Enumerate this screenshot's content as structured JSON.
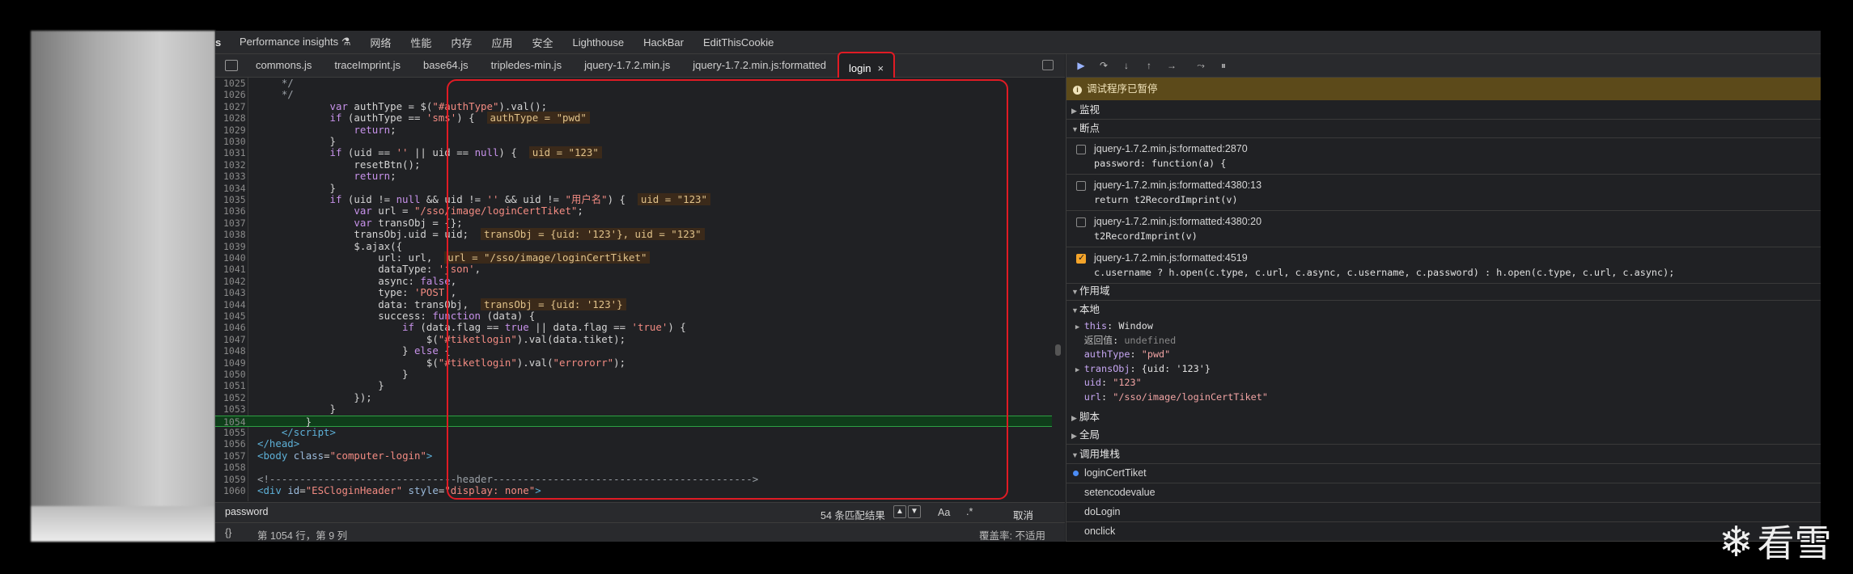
{
  "top_tabs": [
    "Performance insights ⚗",
    "网络",
    "性能",
    "内存",
    "应用",
    "安全",
    "Lighthouse",
    "HackBar",
    "EditThisCookie"
  ],
  "file_tabs": [
    "commons.js",
    "traceImprint.js",
    "base64.js",
    "tripledes-min.js",
    "jquery-1.7.2.min.js",
    "jquery-1.7.2.min.js:formatted"
  ],
  "active_tab": {
    "label": "login",
    "close": "×"
  },
  "editor_lines": [
    {
      "n": "1025",
      "html": "    <span class='cm'>*/</span>"
    },
    {
      "n": "1026",
      "html": "    <span class='cm'>*/</span>"
    },
    {
      "n": "1027",
      "html": "            <span class='kw'>var</span> authType = $(<span class='str'>\"#authType\"</span>).val();"
    },
    {
      "n": "1028",
      "html": "            <span class='kw'>if</span> (authType == <span class='str'>'sms'</span>) {  <span class='inl'>authType = \"pwd\"</span>"
    },
    {
      "n": "1029",
      "html": "                <span class='kw'>return</span>;"
    },
    {
      "n": "1030",
      "html": "            }"
    },
    {
      "n": "1031",
      "html": "            <span class='kw'>if</span> (uid == <span class='str'>''</span> || uid == <span class='kw'>null</span>) {  <span class='inl'>uid = \"123\"</span>"
    },
    {
      "n": "1032",
      "html": "                resetBtn();"
    },
    {
      "n": "1033",
      "html": "                <span class='kw'>return</span>;"
    },
    {
      "n": "1034",
      "html": "            }"
    },
    {
      "n": "1035",
      "html": "            <span class='kw'>if</span> (uid != <span class='kw'>null</span> &amp;&amp; uid != <span class='str'>''</span> &amp;&amp; uid != <span class='str'>\"用户名\"</span>) {  <span class='inl'>uid = \"123\"</span>"
    },
    {
      "n": "1036",
      "html": "                <span class='kw'>var</span> url = <span class='str'>\"/sso/image/loginCertTiket\"</span>;"
    },
    {
      "n": "1037",
      "html": "                <span class='kw'>var</span> transObj = {};"
    },
    {
      "n": "1038",
      "html": "                transObj.uid = uid;  <span class='inl'>transObj = {uid: '123'}, uid = \"123\"</span>"
    },
    {
      "n": "1039",
      "html": "                $.ajax({"
    },
    {
      "n": "1040",
      "html": "                    url: url,  <span class='inl'>url = \"/sso/image/loginCertTiket\"</span>"
    },
    {
      "n": "1041",
      "html": "                    dataType: <span class='str'>'json'</span>,"
    },
    {
      "n": "1042",
      "html": "                    async: <span class='kw'>false</span>,"
    },
    {
      "n": "1043",
      "html": "                    type: <span class='str'>'POST'</span>,"
    },
    {
      "n": "1044",
      "html": "                    data: transObj,  <span class='inl'>transObj = {uid: '123'}</span>"
    },
    {
      "n": "1045",
      "html": "                    success: <span class='kw'>function</span> (data) {"
    },
    {
      "n": "1046",
      "html": "                        <span class='kw'>if</span> (data.flag == <span class='kw'>true</span> || data.flag == <span class='str'>'true'</span>) {"
    },
    {
      "n": "1047",
      "html": "                            $(<span class='str'>\"#tiketlogin\"</span>).val(data.tiket);"
    },
    {
      "n": "1048",
      "html": "                        } <span class='kw'>else</span> {"
    },
    {
      "n": "1049",
      "html": "                            $(<span class='str'>\"#tiketlogin\"</span>).val(<span class='str'>\"errororr\"</span>);"
    },
    {
      "n": "1050",
      "html": "                        }"
    },
    {
      "n": "1051",
      "html": "                    }"
    },
    {
      "n": "1052",
      "html": "                });"
    },
    {
      "n": "1053",
      "html": "            }"
    },
    {
      "n": "1054",
      "html": "        }",
      "current": true
    },
    {
      "n": "1055",
      "html": "    <span class='tag'>&lt;/script&gt;</span>"
    },
    {
      "n": "1056",
      "html": "<span class='tag'>&lt;/head&gt;</span>"
    },
    {
      "n": "1057",
      "html": "<span class='tag'>&lt;body</span> <span class='attr'>class</span>=<span class='val'>\"computer-login\"</span><span class='tag'>&gt;</span>"
    },
    {
      "n": "1058",
      "html": ""
    },
    {
      "n": "1059",
      "html": "<span class='cm'>&lt;!-------------------------------header-------------------------------------------&gt;</span>"
    },
    {
      "n": "1060",
      "html": "<span class='tag'>&lt;div</span> <span class='attr'>id</span>=<span class='val'>\"ESCloginHeader\"</span> <span class='attr'>style</span>=<span class='val'>\"display: none\"</span><span class='tag'>&gt;</span>"
    }
  ],
  "search": {
    "query": "password",
    "count": "54 条匹配结果",
    "match_case": "Aa",
    "regex": ".*",
    "cancel": "取消"
  },
  "status": {
    "braces": "{}",
    "position": "第 1054 行，第 9 列",
    "coverage": "覆盖率: 不适用"
  },
  "paused_msg": "调试程序已暂停",
  "sections": {
    "watch": "监视",
    "breakpoints": "断点",
    "scope": "作用域",
    "local": "本地",
    "script": "脚本",
    "global": "全局",
    "callstack": "调用堆栈"
  },
  "breakpoints": [
    {
      "loc": "jquery-1.7.2.min.js:formatted:2870",
      "src": "password: function(a) {",
      "checked": false
    },
    {
      "loc": "jquery-1.7.2.min.js:formatted:4380:13",
      "src": "return t2RecordImprint(v)",
      "checked": false
    },
    {
      "loc": "jquery-1.7.2.min.js:formatted:4380:20",
      "src": "t2RecordImprint(v)",
      "checked": false
    },
    {
      "loc": "jquery-1.7.2.min.js:formatted:4519",
      "src": "c.username ? h.open(c.type, c.url, c.async, c.username, c.password) : h.open(c.type, c.url, c.async);",
      "checked": true
    }
  ],
  "scope_local": [
    {
      "k": "this",
      "sep": ": ",
      "v": "Window",
      "expand": true,
      "kind": "obj"
    },
    {
      "k": "返回值",
      "sep": ": ",
      "v": "undefined",
      "expand": false,
      "kind": "undef"
    },
    {
      "k": "authType",
      "sep": ": ",
      "v": "\"pwd\"",
      "expand": false,
      "kind": "str"
    },
    {
      "k": "transObj",
      "sep": ": ",
      "v": "{uid: '123'}",
      "expand": true,
      "kind": "obj"
    },
    {
      "k": "uid",
      "sep": ": ",
      "v": "\"123\"",
      "expand": false,
      "kind": "str"
    },
    {
      "k": "url",
      "sep": ": ",
      "v": "\"/sso/image/loginCertTiket\"",
      "expand": false,
      "kind": "str"
    }
  ],
  "callstack": [
    "loginCertTiket",
    "setencodevalue",
    "doLogin",
    "onclick"
  ],
  "watermark": "看雪"
}
